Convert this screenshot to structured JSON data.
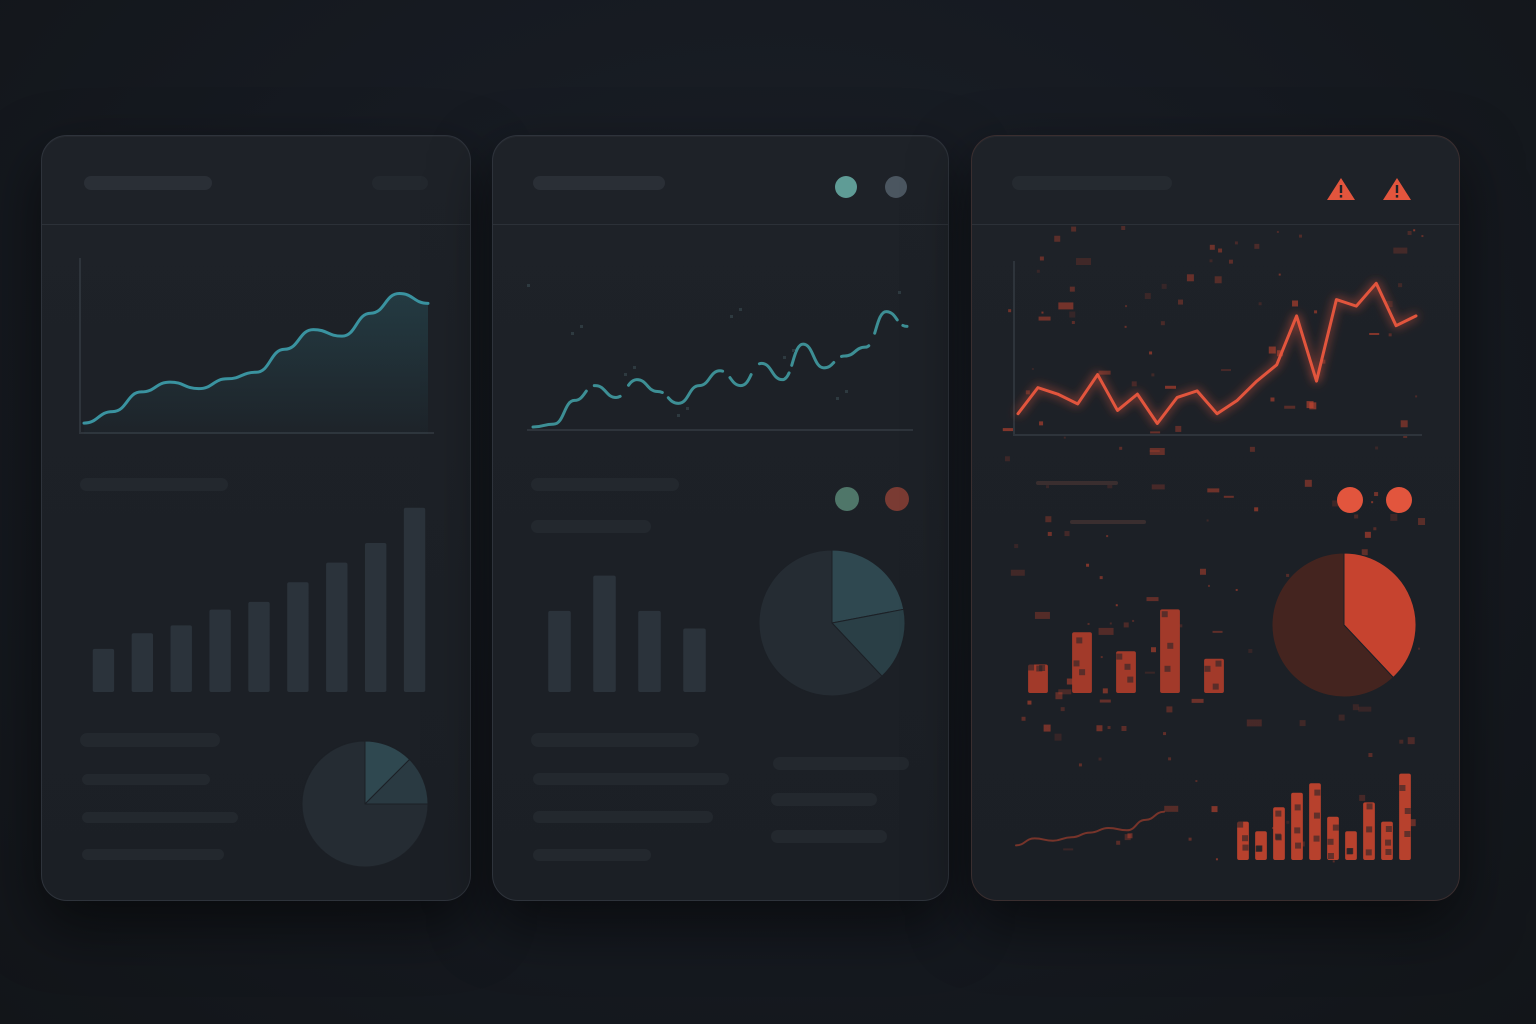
{
  "colors": {
    "background": "#161a21",
    "panel": "#1e2228",
    "healthy_accent": "#3a93a0",
    "degrading_accent": "#3d8f95",
    "critical_accent": "#e2553d",
    "bar_fill": "#2b333b",
    "pie_dark": "#252c33",
    "pie_light": "#2f4850"
  },
  "panels": [
    {
      "state": "healthy",
      "line_chart": {
        "type": "area",
        "points": [
          3,
          10,
          22,
          28,
          24,
          30,
          34,
          48,
          60,
          56,
          70,
          82,
          76
        ]
      },
      "bar_chart": {
        "type": "bar",
        "values": [
          22,
          30,
          34,
          42,
          46,
          56,
          66,
          76,
          94
        ]
      },
      "pie_chart": {
        "type": "pie",
        "slices": [
          0.75,
          0.125,
          0.125
        ]
      }
    },
    {
      "state": "degrading",
      "status_icons": [
        "status-dot-teal-icon",
        "status-dot-gray-icon"
      ],
      "line_chart": {
        "type": "line",
        "points": [
          2,
          4,
          20,
          30,
          22,
          34,
          26,
          18,
          30,
          40,
          30,
          45,
          34,
          58,
          42,
          50,
          56,
          80,
          70
        ]
      },
      "secondary_icons": [
        "status-dot-teal-icon",
        "status-dot-red-icon"
      ],
      "bar_chart": {
        "type": "bar",
        "values": [
          46,
          66,
          46,
          36
        ]
      },
      "pie_chart": {
        "type": "pie",
        "slices": [
          0.62,
          0.22,
          0.16
        ]
      }
    },
    {
      "state": "critical",
      "status_icons": [
        "warning-triangle-icon",
        "warning-triangle-icon"
      ],
      "line_chart": {
        "type": "line",
        "points": [
          10,
          26,
          22,
          16,
          34,
          12,
          22,
          4,
          20,
          24,
          10,
          18,
          30,
          40,
          70,
          30,
          80,
          76,
          90,
          64,
          70
        ]
      },
      "secondary_icons": [
        "alert-dot-icon",
        "alert-dot-icon"
      ],
      "bar_chart": {
        "type": "bar",
        "values": [
          30,
          64,
          44,
          88,
          36
        ]
      },
      "pie_chart": {
        "type": "pie",
        "slices": [
          0.38,
          0.62
        ]
      },
      "mini_line_chart": {
        "type": "line",
        "points": [
          8,
          20,
          16,
          22,
          30,
          38,
          34,
          52,
          66
        ]
      },
      "mini_bar_chart": {
        "type": "bar",
        "values": [
          40,
          30,
          55,
          70,
          80,
          45,
          30,
          60,
          40,
          90
        ]
      }
    }
  ]
}
